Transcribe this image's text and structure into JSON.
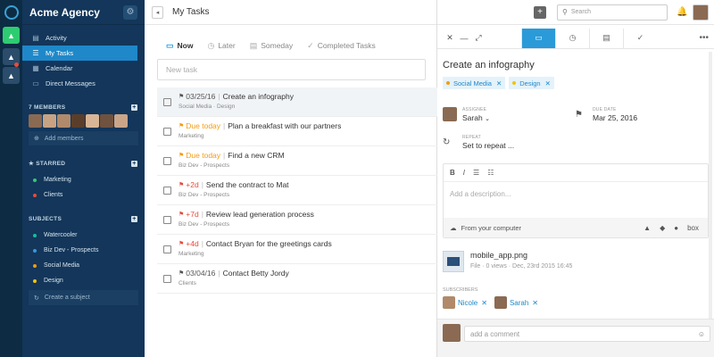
{
  "sidebar": {
    "title": "Acme Agency",
    "nav": [
      {
        "label": "Activity",
        "icon": "activity-icon"
      },
      {
        "label": "My Tasks",
        "icon": "tasks-icon",
        "active": true
      },
      {
        "label": "Calendar",
        "icon": "calendar-icon"
      },
      {
        "label": "Direct Messages",
        "icon": "messages-icon"
      }
    ],
    "members_header": "7 MEMBERS",
    "add_members": "Add members",
    "starred_header": "STARRED",
    "starred": [
      {
        "label": "Marketing",
        "color": "#2ecc71"
      },
      {
        "label": "Clients",
        "color": "#e74c3c"
      }
    ],
    "subjects_header": "SUBJECTS",
    "subjects": [
      {
        "label": "Watercooler",
        "color": "#1abc9c"
      },
      {
        "label": "Biz Dev - Prospects",
        "color": "#3498db"
      },
      {
        "label": "Social Media",
        "color": "#f39c12"
      },
      {
        "label": "Design",
        "color": "#f1c40f"
      }
    ],
    "create_subject": "Create a subject"
  },
  "main": {
    "title": "My Tasks",
    "tabs": [
      "Now",
      "Later",
      "Someday",
      "Completed Tasks"
    ],
    "new_task_placeholder": "New task",
    "tasks": [
      {
        "due": "03/25/16",
        "due_color": "#555",
        "title": "Create an infography",
        "sub": "Social Media · Design",
        "selected": true
      },
      {
        "due": "Due today",
        "due_color": "#f39c12",
        "title": "Plan a breakfast with our partners",
        "sub": "Marketing"
      },
      {
        "due": "Due today",
        "due_color": "#f39c12",
        "title": "Find a new CRM",
        "sub": "Biz Dev - Prospects"
      },
      {
        "due": "+2d",
        "due_color": "#e74c3c",
        "title": "Send the contract to Mat",
        "sub": "Biz Dev - Prospects"
      },
      {
        "due": "+7d",
        "due_color": "#e74c3c",
        "title": "Review lead generation process",
        "sub": "Biz Dev - Prospects"
      },
      {
        "due": "+4d",
        "due_color": "#e74c3c",
        "title": "Contact Bryan for the greetings cards",
        "sub": "Marketing"
      },
      {
        "due": "03/04/16",
        "due_color": "#555",
        "title": "Contact Betty Jordy",
        "sub": "Clients"
      }
    ]
  },
  "top": {
    "search_placeholder": "Search"
  },
  "detail": {
    "title": "Create an infography",
    "tags": [
      {
        "label": "Social Media",
        "color": "#f39c12"
      },
      {
        "label": "Design",
        "color": "#f1c40f"
      }
    ],
    "assignee_label": "ASSIGNEE",
    "assignee": "Sarah",
    "due_label": "DUE DATE",
    "due": "Mar 25, 2016",
    "repeat_label": "REPEAT",
    "repeat": "Set to repeat ...",
    "description_placeholder": "Add a description...",
    "from_computer": "From your computer",
    "cloud": [
      "box"
    ],
    "file_name": "mobile_app.png",
    "file_meta": "File · 0 views · Dec, 23rd 2015 16:45",
    "subscribers_label": "SUBSCRIBERS",
    "subscribers": [
      "Nicole",
      "Sarah"
    ],
    "comment_placeholder": "add a comment"
  }
}
